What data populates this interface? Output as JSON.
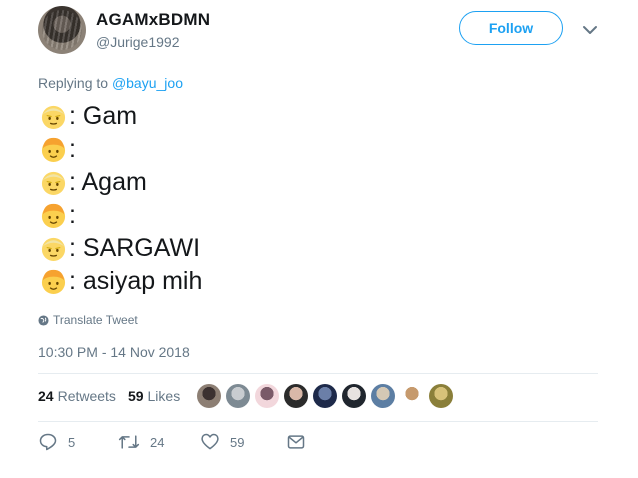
{
  "user": {
    "display_name": "AGAMxBDMN",
    "handle": "@Jurige1992"
  },
  "follow_label": "Follow",
  "reply": {
    "prefix": "Replying to ",
    "target": "@bayu_joo"
  },
  "tweet_lines": [
    {
      "emoji": "older-man-emoji",
      "text": ": Gam"
    },
    {
      "emoji": "boy-emoji",
      "text": ":"
    },
    {
      "emoji": "older-man-emoji",
      "text": ": Agam"
    },
    {
      "emoji": "boy-emoji",
      "text": ":"
    },
    {
      "emoji": "older-man-emoji",
      "text": ": SARGAWI"
    },
    {
      "emoji": "boy-emoji",
      "text": ": asiyap mih"
    }
  ],
  "translate_label": "Translate Tweet",
  "timestamp": "10:30 PM - 14 Nov 2018",
  "stats": {
    "retweets_count": "24",
    "retweets_label": "Retweets",
    "likes_count": "59",
    "likes_label": "Likes"
  },
  "likers": [
    "liker-1",
    "liker-2",
    "liker-3",
    "liker-4",
    "liker-5",
    "liker-6",
    "liker-7",
    "liker-8",
    "liker-9"
  ],
  "actions": {
    "reply_count": "5",
    "retweet_count": "24",
    "like_count": "59"
  },
  "colors": {
    "accent": "#1da1f2",
    "muted": "#657786",
    "text": "#14171a",
    "divider": "#e6ecf0"
  }
}
